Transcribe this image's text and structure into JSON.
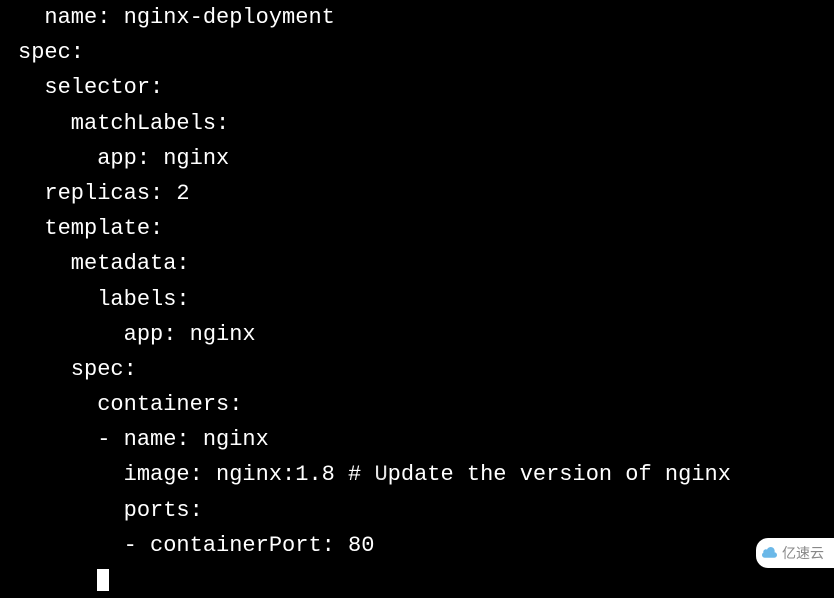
{
  "code": {
    "line1": "  name: nginx-deployment",
    "line2": "spec:",
    "line3": "  selector:",
    "line4": "    matchLabels:",
    "line5": "      app: nginx",
    "line6": "  replicas: 2",
    "line7": "  template:",
    "line8": "    metadata:",
    "line9": "      labels:",
    "line10": "        app: nginx",
    "line11": "    spec:",
    "line12": "      containers:",
    "line13": "      - name: nginx",
    "line14_prefix": "        image: nginx:1.8 # ",
    "line14_cursor_char": "U",
    "line14_suffix": "pdate the version of nginx",
    "line15": "        ports:",
    "line16": "        - containerPort: 80"
  },
  "watermark": {
    "text": "亿速云"
  }
}
